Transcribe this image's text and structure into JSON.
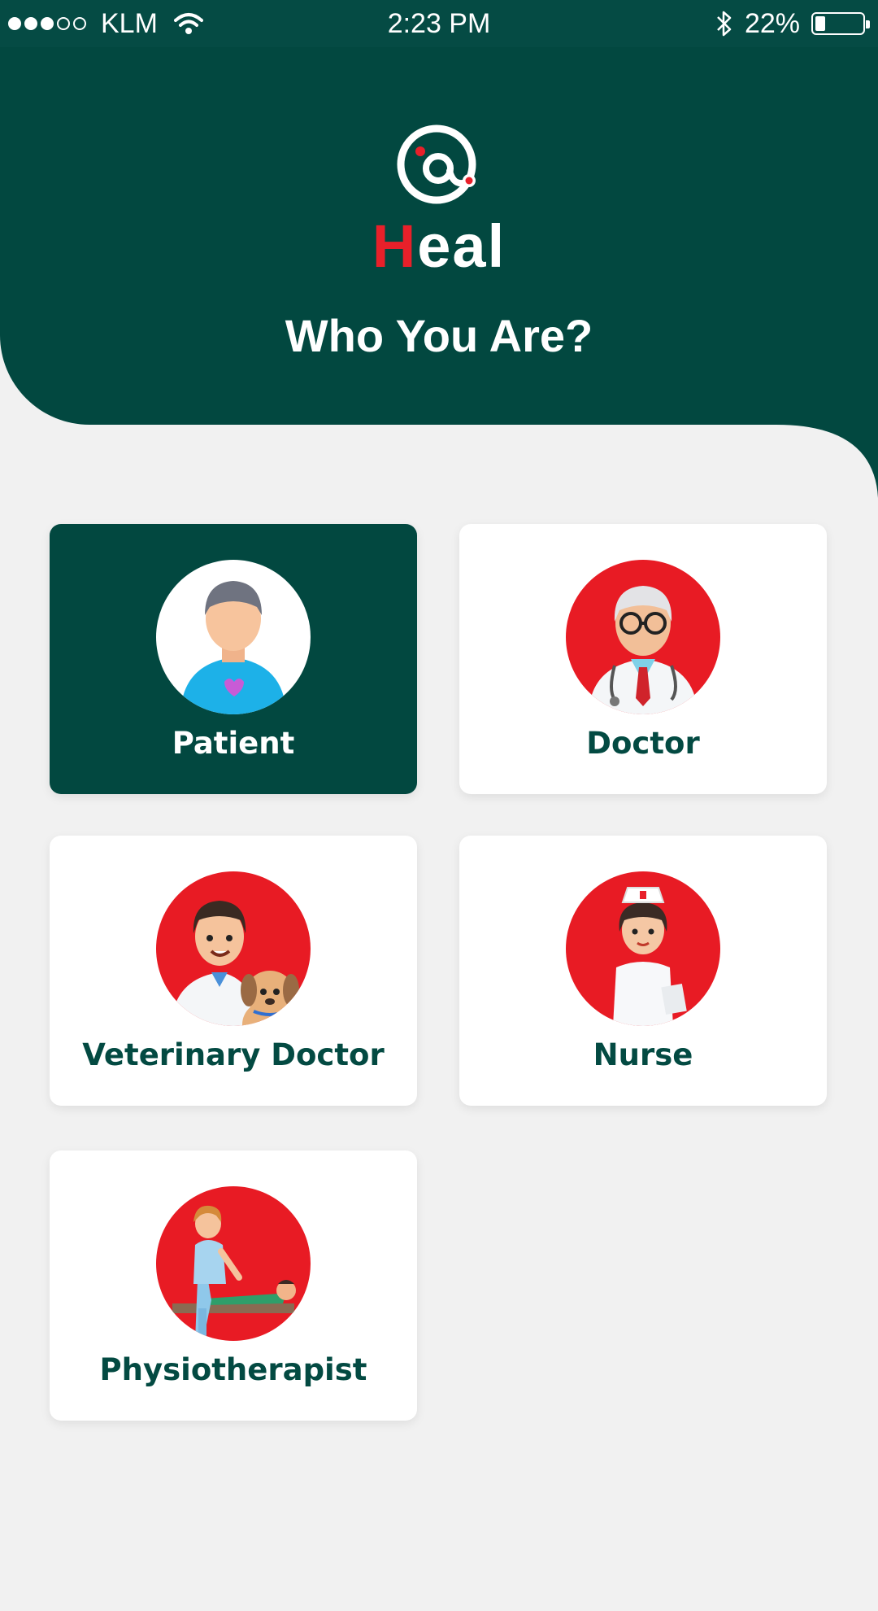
{
  "status_bar": {
    "carrier": "KLM",
    "time": "2:23 PM",
    "battery_percent": "22%",
    "battery_level": 0.22,
    "signal_bars_filled": 3,
    "signal_bars_total": 5
  },
  "brand": {
    "name": "Heal",
    "name_prefix": "H",
    "name_rest": "eal",
    "accent_color": "#e8202a",
    "primary_color": "#024840"
  },
  "header": {
    "title": "Who You Are?"
  },
  "roles": [
    {
      "label": "Patient",
      "selected": true,
      "icon": "patient-icon"
    },
    {
      "label": "Doctor",
      "selected": false,
      "icon": "doctor-icon"
    },
    {
      "label": "Veterinary Doctor",
      "selected": false,
      "icon": "veterinary-doctor-icon"
    },
    {
      "label": "Nurse",
      "selected": false,
      "icon": "nurse-icon"
    },
    {
      "label": "Physiotherapist",
      "selected": false,
      "icon": "physiotherapist-icon"
    }
  ]
}
